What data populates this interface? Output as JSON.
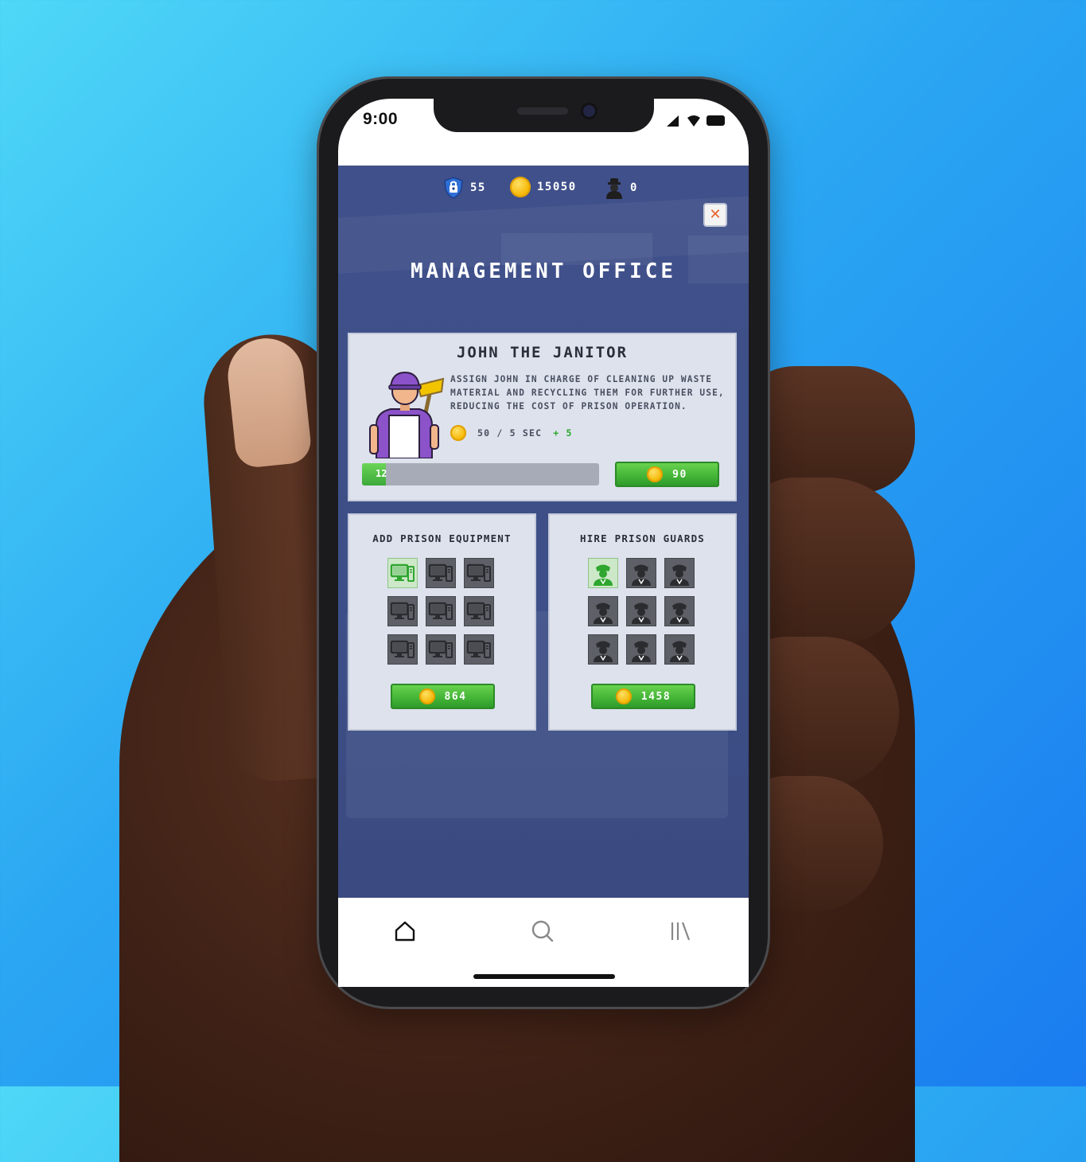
{
  "status_bar": {
    "time": "9:00"
  },
  "hud": {
    "shield_count": "55",
    "coin_count": "15050",
    "prisoner_count": "0"
  },
  "page": {
    "title": "MANAGEMENT OFFICE",
    "close_symbol": "✕"
  },
  "janitor": {
    "name": "JOHN THE JANITOR",
    "description": "ASSIGN JOHN IN CHARGE OF CLEANING UP WASTE MATERIAL AND RECYCLING THEM FOR FURTHER USE, REDUCING THE COST OF PRISON OPERATION.",
    "rate": "50 / 5 SEC",
    "bonus": "+ 5",
    "progress_label": "12",
    "progress_fraction": 0.1,
    "upgrade_cost": "90"
  },
  "equipment": {
    "title": "ADD PRISON EQUIPMENT",
    "slots_total": 9,
    "slots_owned": 1,
    "cost": "864"
  },
  "guards": {
    "title": "HIRE PRISON GUARDS",
    "slots_total": 9,
    "slots_owned": 1,
    "cost": "1458"
  },
  "bottom_nav": [
    "home-icon",
    "search-icon",
    "library-icon"
  ],
  "colors": {
    "accent_green": "#42b336",
    "game_bg": "#3d4f88",
    "coin": "#f5b600",
    "close": "#e8642c"
  }
}
